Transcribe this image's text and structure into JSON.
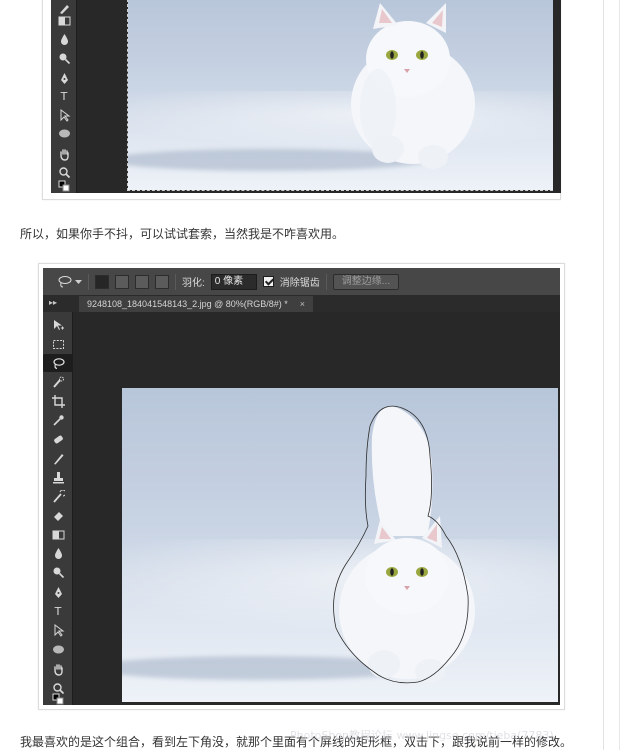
{
  "article": {
    "paragraph1": "所以，如果你手不抖，可以试试套索，当然我是不咋喜欢用。",
    "paragraph2": "我最喜欢的是这个组合，看到左下角没，就那个里面有个屏线的矩形框，双击下，跟我说前一样的修改。"
  },
  "screenshot1": {
    "tools": [
      "pen-tool",
      "type-tool",
      "path-selection-tool",
      "ellipse-tool",
      "hand-tool",
      "zoom-tool"
    ],
    "type_glyph": "T"
  },
  "screenshot2": {
    "options_bar": {
      "feather_label": "羽化:",
      "feather_value": "0 像素",
      "antialias_label": "消除锯齿",
      "antialias_checked": true,
      "refine_edge_label": "调整边缘..."
    },
    "panel_arrows": "▸▸",
    "doc_tab": {
      "title": "9248108_184041548143_2.jpg @ 80%(RGB/8#) *",
      "close": "×"
    },
    "type_glyph": "T"
  },
  "watermark": "PhotoShop教程论坛 www.lingse.com/tieba(7783)",
  "colors": {
    "ps_background": "#282828",
    "ps_panel": "#3a3a3a",
    "sky": "#c9d4e4",
    "snow": "#eef2f8"
  }
}
